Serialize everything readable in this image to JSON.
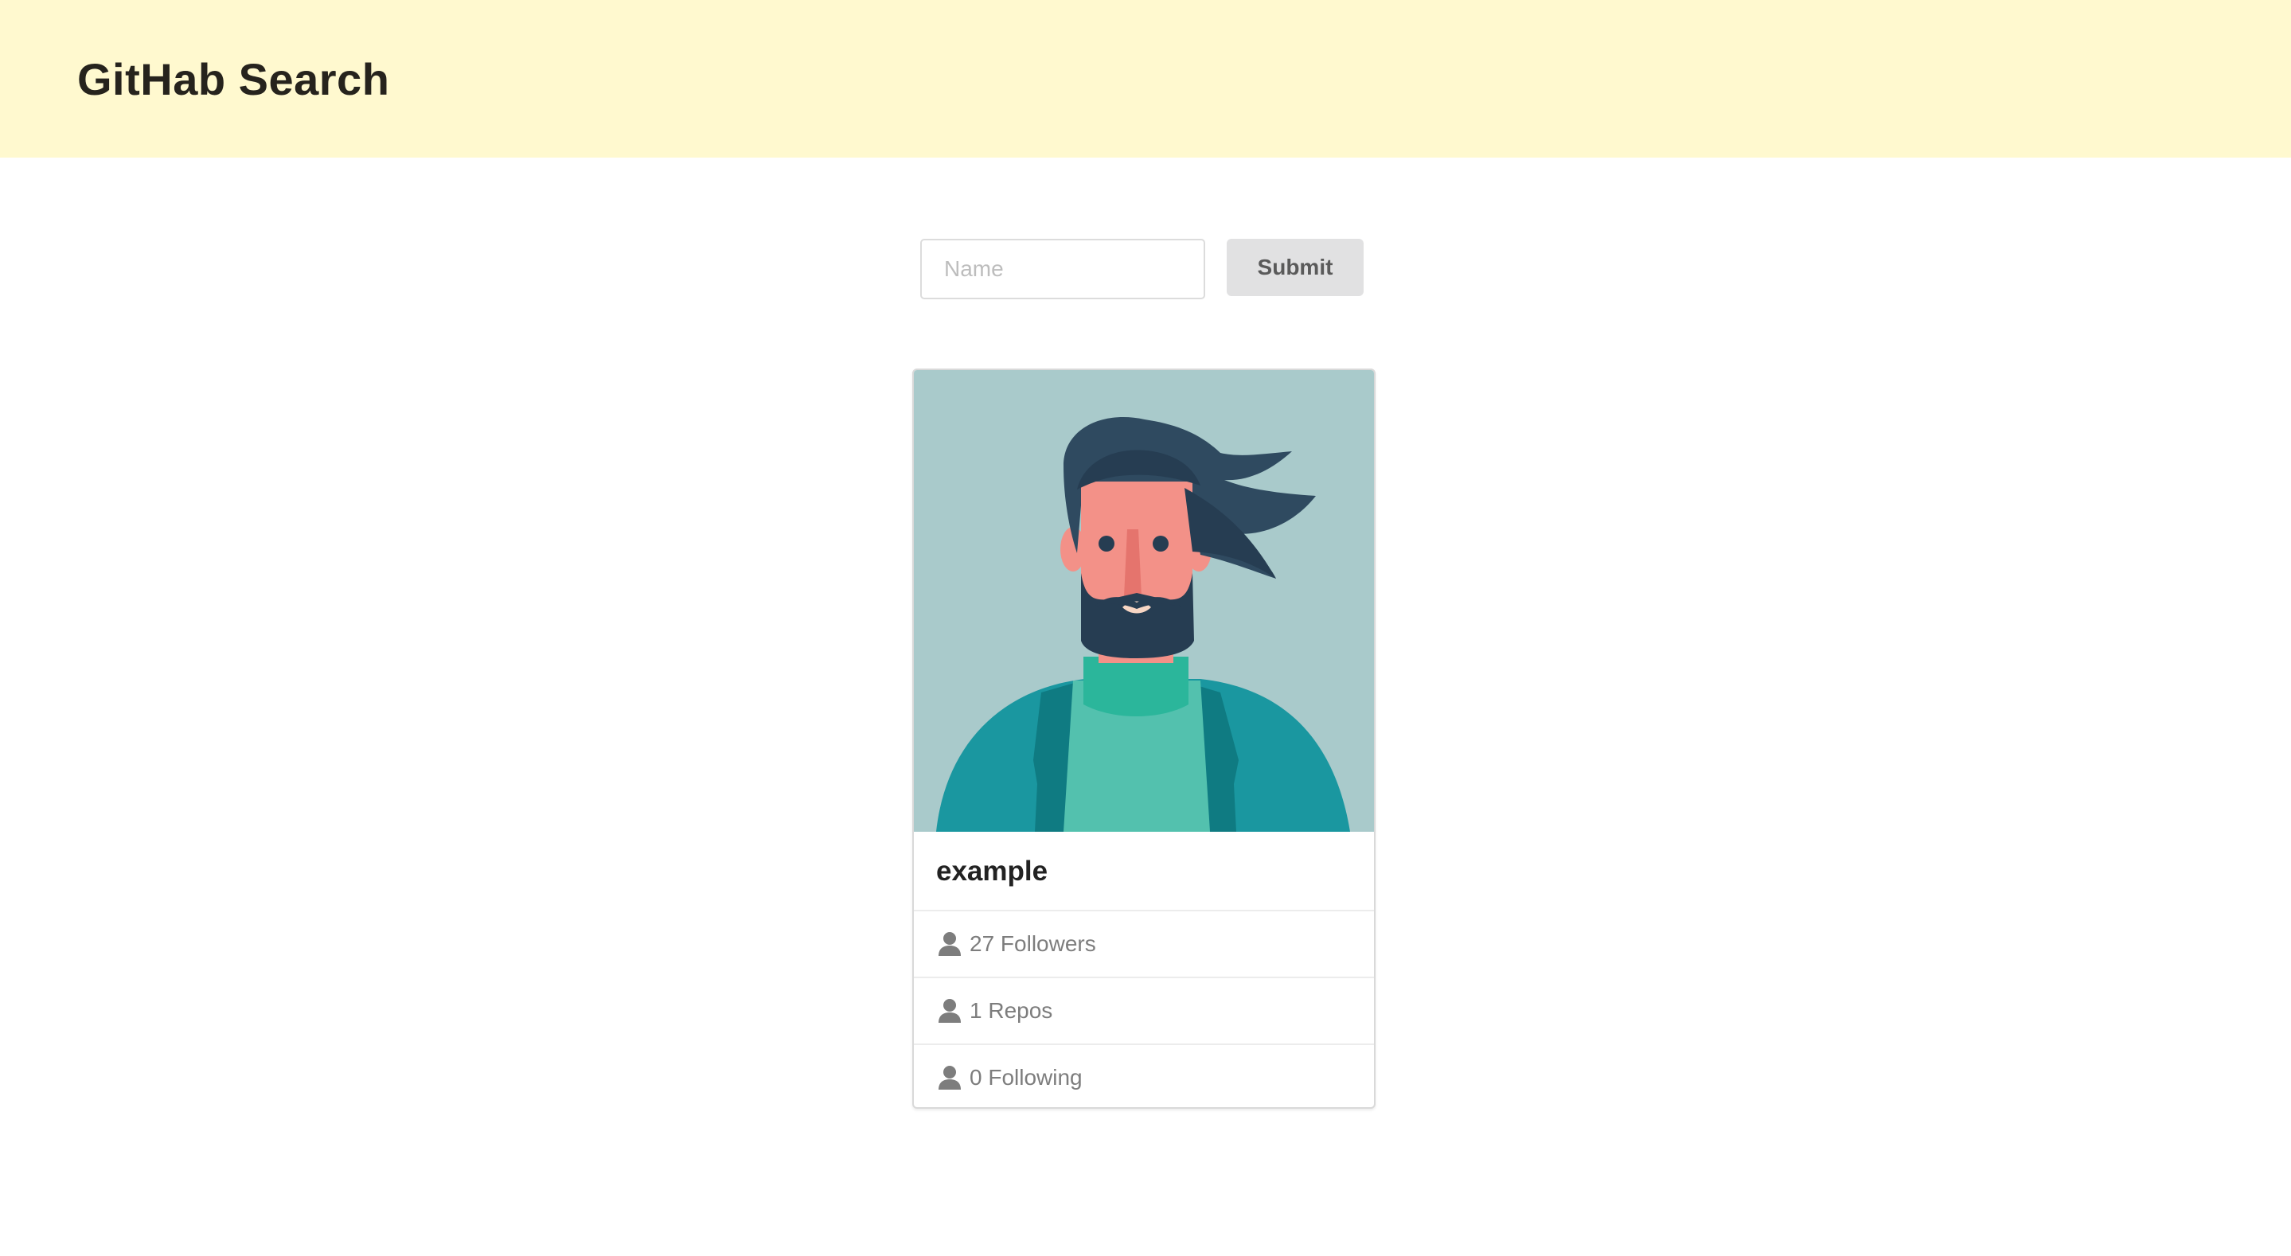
{
  "header": {
    "title": "GitHab Search",
    "background": "#fff9cf"
  },
  "search": {
    "placeholder": "Name",
    "value": "",
    "submit_label": "Submit"
  },
  "profile": {
    "name": "example",
    "avatar_icon": "person-avatar-illustration",
    "stats": [
      {
        "icon": "user-icon",
        "label": "27 Followers"
      },
      {
        "icon": "user-icon",
        "label": "1 Repos"
      },
      {
        "icon": "user-icon",
        "label": "0 Following"
      }
    ]
  },
  "colors": {
    "avatar_background": "#a9cacb",
    "hair": "#2f4a60",
    "skin": "#f39188",
    "sweater": "#53c1ae",
    "jacket": "#1a97a0"
  }
}
